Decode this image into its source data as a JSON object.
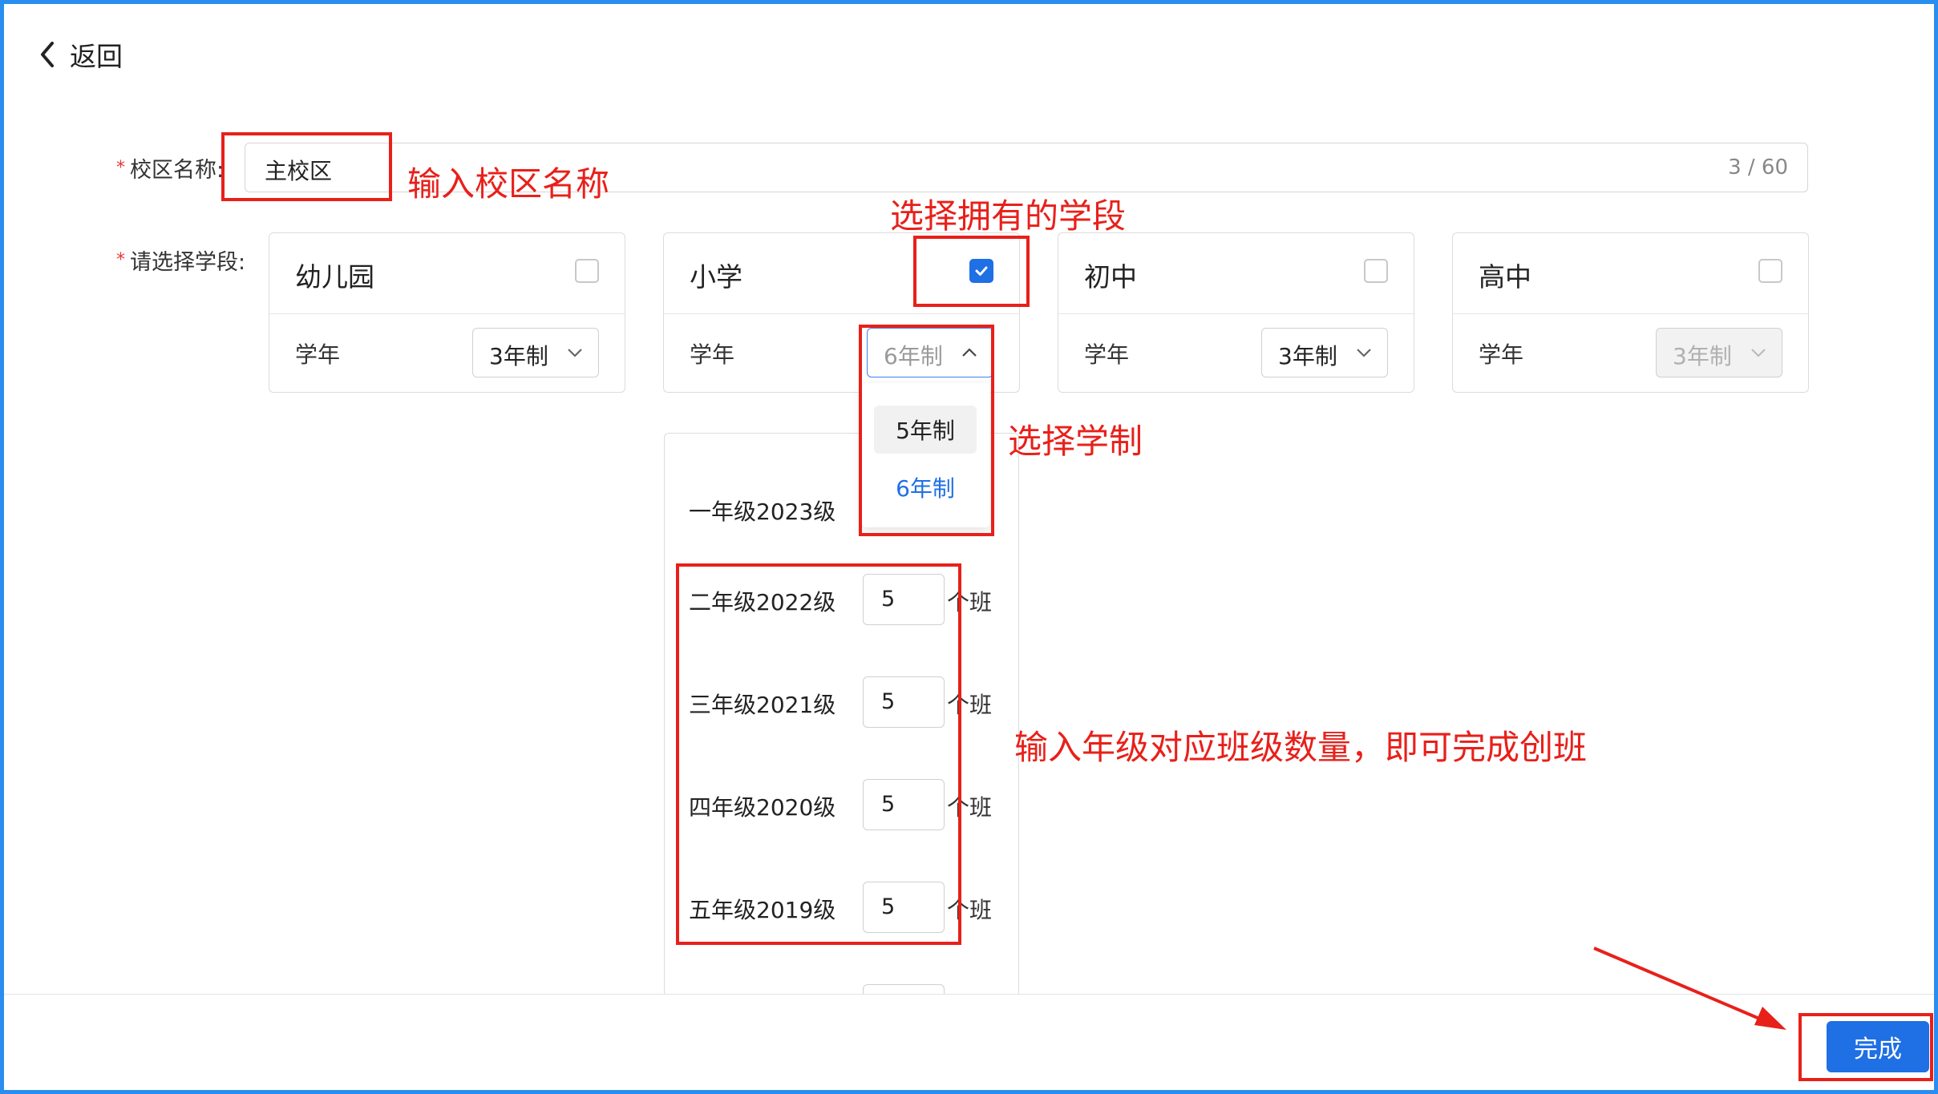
{
  "header": {
    "back_label": "返回"
  },
  "form": {
    "campus_label": "校区名称:",
    "campus_value": "主校区",
    "campus_count": "3 / 60",
    "stage_label": "请选择学段:"
  },
  "stages": [
    {
      "title": "幼儿园",
      "year_label": "学年",
      "select": "3年制",
      "checked": false
    },
    {
      "title": "小学",
      "year_label": "学年",
      "select": "6年制",
      "checked": true
    },
    {
      "title": "初中",
      "year_label": "学年",
      "select": "3年制",
      "checked": false
    },
    {
      "title": "高中",
      "year_label": "学年",
      "select": "3年制",
      "checked": false
    }
  ],
  "dropdown": {
    "options": [
      "5年制",
      "6年制"
    ],
    "selected": "6年制"
  },
  "grades": [
    {
      "label": "一年级2023级",
      "count": "",
      "unit": ""
    },
    {
      "label": "二年级2022级",
      "count": "5",
      "unit": "个班"
    },
    {
      "label": "三年级2021级",
      "count": "5",
      "unit": "个班"
    },
    {
      "label": "四年级2020级",
      "count": "5",
      "unit": "个班"
    },
    {
      "label": "五年级2019级",
      "count": "5",
      "unit": "个班"
    }
  ],
  "footer": {
    "done_label": "完成"
  },
  "annotations": {
    "campus_name": "输入校区名称",
    "choose_stage": "选择拥有的学段",
    "choose_system": "选择学制",
    "class_count": "输入年级对应班级数量，即可完成创班"
  },
  "colors": {
    "primary": "#1f6fe5",
    "annotation": "#e8201a",
    "frame": "#2a8df0"
  }
}
